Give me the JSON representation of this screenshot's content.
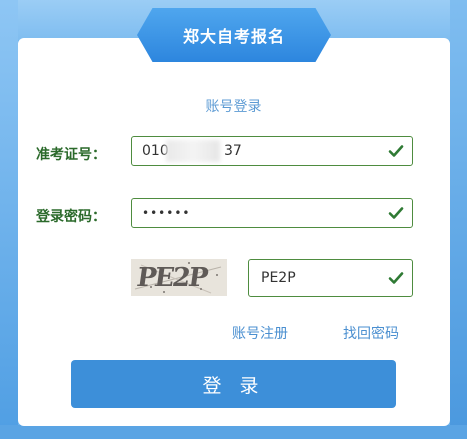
{
  "header": {
    "title": "郑大自考报名"
  },
  "tabs": {
    "account_login": "账号登录"
  },
  "form": {
    "exam_id_label": "准考证号：",
    "exam_id_value_prefix": "010",
    "exam_id_value_suffix": "37",
    "password_label": "登录密码：",
    "password_value": "••••••",
    "captcha_image_text": "PE2P",
    "captcha_value": "PE2P"
  },
  "links": {
    "register": "账号注册",
    "recover_password": "找回密码"
  },
  "login_button": "登 录",
  "colors": {
    "accent": "#3d8fd9",
    "valid_green": "#4e8c3f",
    "label_green": "#2b6a2b"
  }
}
